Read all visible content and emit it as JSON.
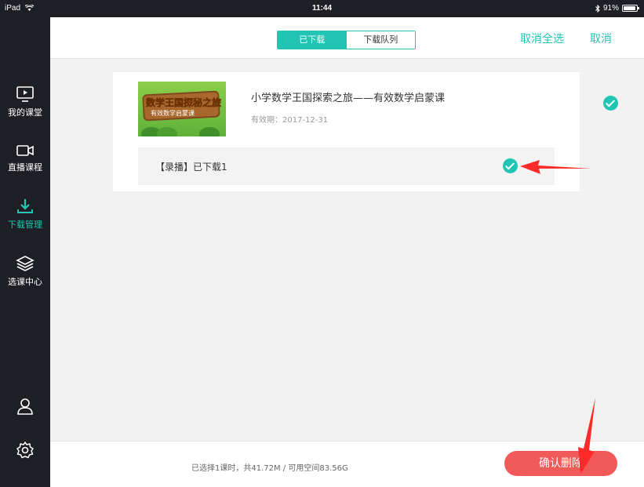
{
  "statusbar": {
    "device": "iPad",
    "time": "11:44",
    "battery": "91%",
    "battery_level": 0.91
  },
  "sidebar": {
    "items": [
      {
        "label": "我的课堂",
        "icon": "monitor-play-icon"
      },
      {
        "label": "直播课程",
        "icon": "video-camera-icon"
      },
      {
        "label": "下载管理",
        "icon": "download-icon",
        "active": true
      },
      {
        "label": "选课中心",
        "icon": "layers-icon"
      }
    ],
    "bottom_icons": [
      "user-icon",
      "settings-gear-icon"
    ]
  },
  "topbar": {
    "tab_downloaded": "已下载",
    "tab_queue": "下载队列",
    "deselect_all": "取消全选",
    "cancel": "取消"
  },
  "course": {
    "title": "小学数学王国探索之旅——有效数学启蒙课",
    "expiry": "有效期：2017-12-31",
    "thumbnail_text": "数学王国探秘之旅",
    "thumbnail_subtext": "有效数学启蒙课",
    "lesson_label": "【录播】已下载1"
  },
  "footer": {
    "summary": "已选择1课时，共41.72M / 可用空间83.56G",
    "confirm_delete": "确认删除"
  },
  "colors": {
    "accent": "#22c5b4",
    "danger": "#f25a5a",
    "sidebar_bg": "#1e1f24",
    "annotation_arrow": "#ff2a2a"
  }
}
